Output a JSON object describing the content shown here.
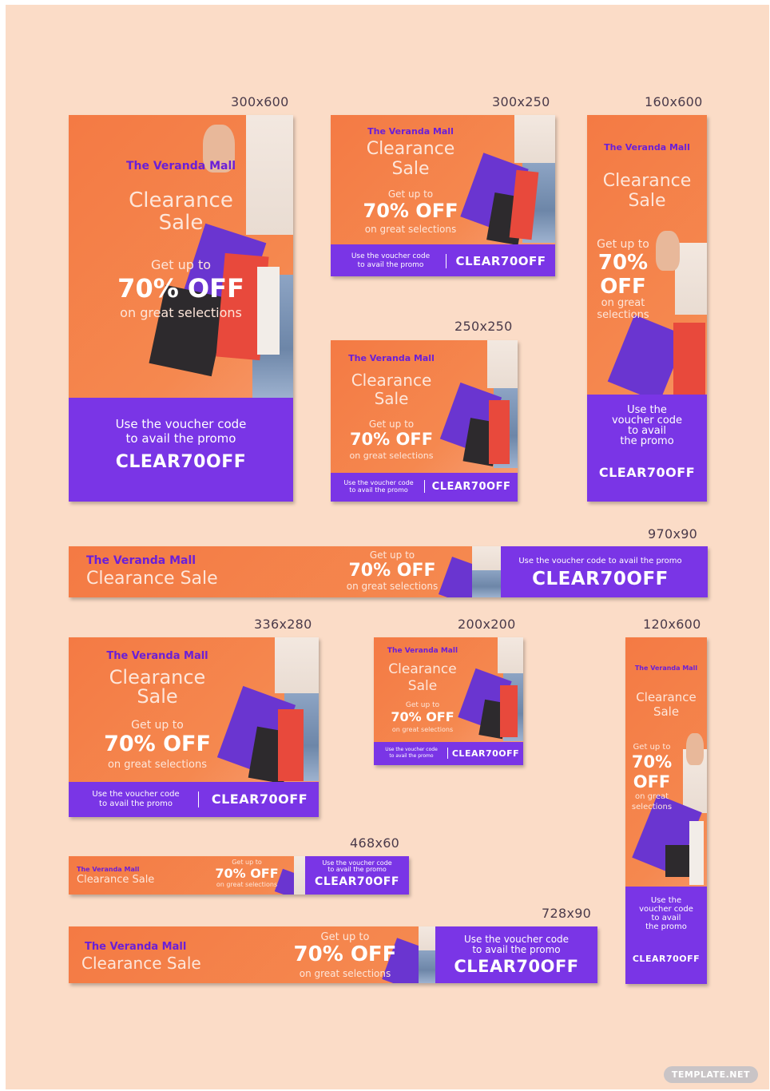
{
  "sizes": {
    "s300x600": "300x600",
    "s300x250": "300x250",
    "s160x600": "160x600",
    "s250x250": "250x250",
    "s970x90": "970x90",
    "s336x280": "336x280",
    "s200x200": "200x200",
    "s120x600": "120x600",
    "s468x60": "468x60",
    "s728x90": "728x90"
  },
  "banner": {
    "mall": "The Veranda Mall",
    "clearance": "Clearance",
    "sale": "Sale",
    "clearance_sale": "Clearance Sale",
    "get_up_to": "Get up to",
    "seventy": "70%",
    "off": "OFF",
    "seventy_off": "70% OFF",
    "on_great": "on great",
    "selections": "selections",
    "on_great_selections": "on great selections",
    "use_the": "Use the",
    "voucher_code": "voucher code",
    "to_avail": "to avail",
    "the_promo": "the promo",
    "use_voucher_code": "Use the voucher code",
    "to_avail_promo": "to avail the promo",
    "voucher_full": "Use the voucher code to avail the promo",
    "code": "CLEAR70OFF"
  },
  "watermark": "TEMPLATE.NET",
  "colors": {
    "background": "#fbdcc7",
    "orange": "#f47a44",
    "purple": "#7a35e6",
    "mall_text": "#6a1fd8"
  }
}
